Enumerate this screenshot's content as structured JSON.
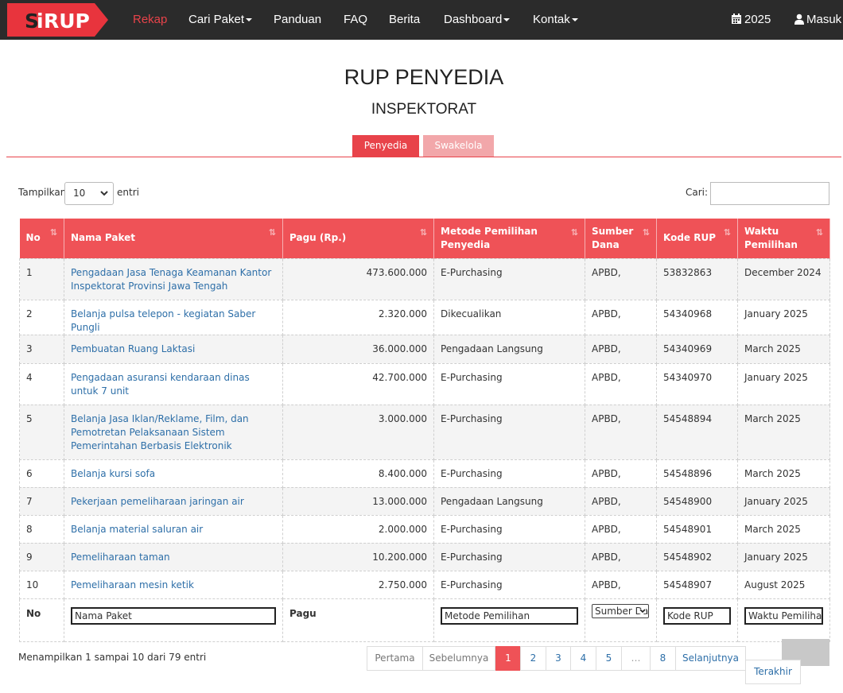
{
  "navbar": {
    "logo_text": "SiRUP",
    "items": [
      {
        "label": "Rekap",
        "active": true
      },
      {
        "label": "Cari Paket",
        "dropdown": true
      },
      {
        "label": "Panduan"
      },
      {
        "label": "FAQ"
      },
      {
        "label": "Berita"
      },
      {
        "label": "Dashboard",
        "dropdown": true
      },
      {
        "label": "Kontak",
        "dropdown": true
      }
    ],
    "year": "2025",
    "login": "Masuk",
    "year_icon": "calendar-icon",
    "login_icon": "user-icon"
  },
  "page": {
    "title": "RUP PENYEDIA",
    "subtitle": "INSPEKTORAT"
  },
  "tabs": [
    {
      "label": "Penyedia",
      "active": true
    },
    {
      "label": "Swakelola",
      "active": false
    }
  ],
  "controls": {
    "length_label": "Tampilkan",
    "length_value": "10",
    "length_suffix": "entri",
    "search_label": "Cari:",
    "search_value": ""
  },
  "table": {
    "columns": [
      "No",
      "Nama Paket",
      "Pagu (Rp.)",
      "Metode Pemilihan Penyedia",
      "Sumber Dana",
      "Kode RUP",
      "Waktu Pemilihan"
    ],
    "rows": [
      {
        "no": "1",
        "nama": "Pengadaan Jasa Tenaga Keamanan Kantor Inspektorat Provinsi Jawa Tengah",
        "pagu": "473.600.000",
        "metode": "E-Purchasing",
        "sumber": "APBD,",
        "kode": "53832863",
        "waktu": "December 2024"
      },
      {
        "no": "2",
        "nama": "Belanja pulsa telepon - kegiatan Saber Pungli",
        "pagu": "2.320.000",
        "metode": "Dikecualikan",
        "sumber": "APBD,",
        "kode": "54340968",
        "waktu": "January 2025"
      },
      {
        "no": "3",
        "nama": "Pembuatan Ruang Laktasi",
        "pagu": "36.000.000",
        "metode": "Pengadaan Langsung",
        "sumber": "APBD,",
        "kode": "54340969",
        "waktu": "March 2025"
      },
      {
        "no": "4",
        "nama": "Pengadaan asuransi kendaraan dinas untuk 7 unit",
        "pagu": "42.700.000",
        "metode": "E-Purchasing",
        "sumber": "APBD,",
        "kode": "54340970",
        "waktu": "January 2025"
      },
      {
        "no": "5",
        "nama": "Belanja Jasa Iklan/Reklame, Film, dan Pemotretan Pelaksanaan Sistem Pemerintahan Berbasis Elektronik",
        "pagu": "3.000.000",
        "metode": "E-Purchasing",
        "sumber": "APBD,",
        "kode": "54548894",
        "waktu": "March 2025"
      },
      {
        "no": "6",
        "nama": "Belanja kursi sofa",
        "pagu": "8.400.000",
        "metode": "E-Purchasing",
        "sumber": "APBD,",
        "kode": "54548896",
        "waktu": "March 2025"
      },
      {
        "no": "7",
        "nama": "Pekerjaan pemeliharaan jaringan air",
        "pagu": "13.000.000",
        "metode": "Pengadaan Langsung",
        "sumber": "APBD,",
        "kode": "54548900",
        "waktu": "January 2025"
      },
      {
        "no": "8",
        "nama": "Belanja material saluran air",
        "pagu": "2.000.000",
        "metode": "E-Purchasing",
        "sumber": "APBD,",
        "kode": "54548901",
        "waktu": "March 2025"
      },
      {
        "no": "9",
        "nama": "Pemeliharaan taman",
        "pagu": "10.200.000",
        "metode": "E-Purchasing",
        "sumber": "APBD,",
        "kode": "54548902",
        "waktu": "January 2025"
      },
      {
        "no": "10",
        "nama": "Pemeliharaan mesin ketik",
        "pagu": "2.750.000",
        "metode": "E-Purchasing",
        "sumber": "APBD,",
        "kode": "54548907",
        "waktu": "August 2025"
      }
    ],
    "footer": {
      "no": "No",
      "nama_placeholder": "Nama Paket",
      "pagu": "Pagu",
      "metode_placeholder": "Metode Pemilihan",
      "sumber_value": "Sumber Dana",
      "kode_placeholder": "Kode RUP",
      "waktu_placeholder": "Waktu Pemilihan"
    }
  },
  "info": "Menampilkan 1 sampai 10 dari 79 entri",
  "pagination": {
    "first": "Pertama",
    "prev": "Sebelumnya",
    "pages": [
      "1",
      "2",
      "3",
      "4",
      "5",
      "…",
      "8"
    ],
    "current": "1",
    "next": "Selanjutnya",
    "last": "Terakhir"
  },
  "colors": {
    "accent": "#ef5257",
    "navbar": "#2b2b2b",
    "link": "#2e6fa8",
    "tab_inactive": "#f2a7aa"
  }
}
